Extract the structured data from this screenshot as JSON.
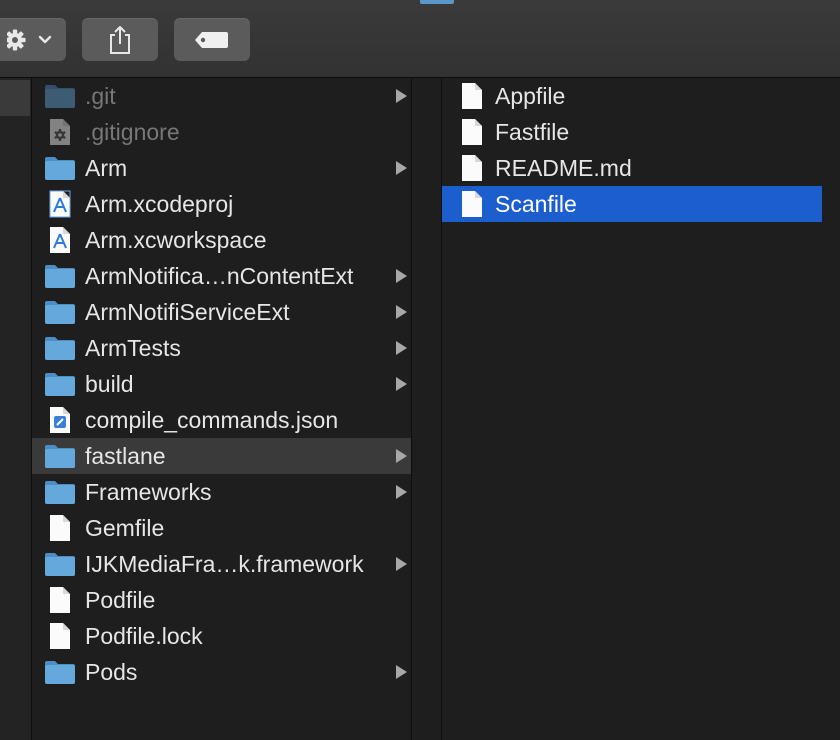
{
  "window": {
    "title": ""
  },
  "toolbar": {
    "buttons": [
      {
        "name": "action-menu",
        "icon": "gear-icon"
      },
      {
        "name": "share",
        "icon": "share-icon"
      },
      {
        "name": "tags",
        "icon": "tag-icon"
      }
    ]
  },
  "column2": {
    "items": [
      {
        "label": ".git",
        "kind": "folder",
        "dim": true,
        "has_children": true
      },
      {
        "label": ".gitignore",
        "kind": "config-file",
        "dim": true,
        "has_children": false
      },
      {
        "label": "Arm",
        "kind": "folder",
        "dim": false,
        "has_children": true
      },
      {
        "label": "Arm.xcodeproj",
        "kind": "xcode-project",
        "dim": false,
        "has_children": false
      },
      {
        "label": "Arm.xcworkspace",
        "kind": "xcode-workspace",
        "dim": false,
        "has_children": false
      },
      {
        "label": "ArmNotifica…nContentExt",
        "kind": "folder",
        "dim": false,
        "has_children": true
      },
      {
        "label": "ArmNotifiServiceExt",
        "kind": "folder",
        "dim": false,
        "has_children": true
      },
      {
        "label": "ArmTests",
        "kind": "folder",
        "dim": false,
        "has_children": true
      },
      {
        "label": "build",
        "kind": "folder",
        "dim": false,
        "has_children": true
      },
      {
        "label": "compile_commands.json",
        "kind": "json-file",
        "dim": false,
        "has_children": false
      },
      {
        "label": "fastlane",
        "kind": "folder",
        "dim": false,
        "has_children": true,
        "selected": true
      },
      {
        "label": "Frameworks",
        "kind": "folder",
        "dim": false,
        "has_children": true
      },
      {
        "label": "Gemfile",
        "kind": "document",
        "dim": false,
        "has_children": false
      },
      {
        "label": "IJKMediaFra…k.framework",
        "kind": "folder",
        "dim": false,
        "has_children": true
      },
      {
        "label": "Podfile",
        "kind": "document",
        "dim": false,
        "has_children": false
      },
      {
        "label": "Podfile.lock",
        "kind": "document",
        "dim": false,
        "has_children": false
      },
      {
        "label": "Pods",
        "kind": "folder",
        "dim": false,
        "has_children": true
      }
    ]
  },
  "column3": {
    "items": [
      {
        "label": "Appfile",
        "kind": "document"
      },
      {
        "label": "Fastfile",
        "kind": "document"
      },
      {
        "label": "README.md",
        "kind": "document"
      },
      {
        "label": "Scanfile",
        "kind": "document",
        "selected": true
      }
    ]
  },
  "colors": {
    "background": "#1e1e1e",
    "selection_active": "#1d5ecf",
    "selection_inactive": "#3a3a3a",
    "folder": "#64a8dc",
    "text": "#e6e6e6",
    "text_dim": "#777777"
  }
}
